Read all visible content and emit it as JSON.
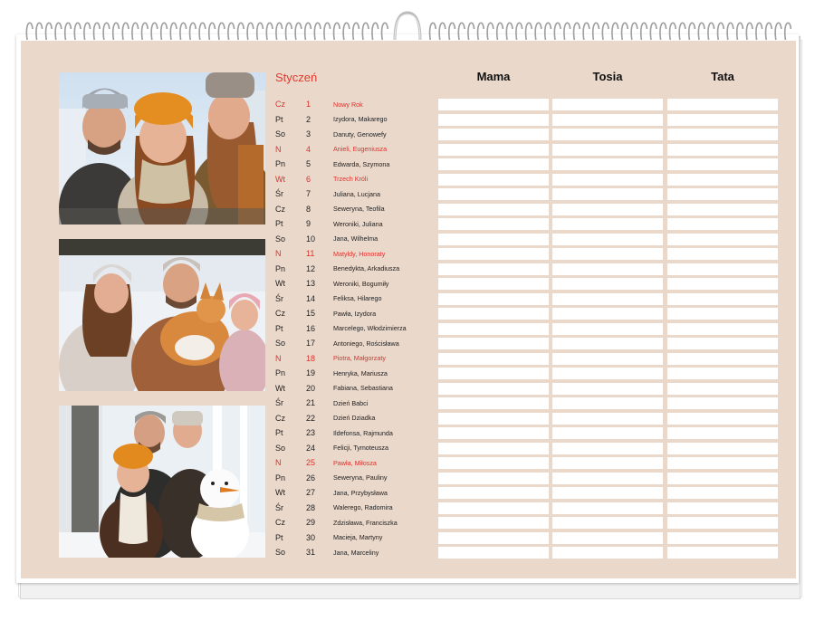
{
  "calendar": {
    "month": "Styczeń",
    "accent_color": "#e03a2e",
    "background_color": "#ead8cb",
    "columns": [
      "Mama",
      "Tosia",
      "Tata"
    ],
    "days": [
      {
        "dn": "Cz",
        "num": "1",
        "name": "Nowy Rok",
        "red": true
      },
      {
        "dn": "Pt",
        "num": "2",
        "name": "Izydora, Makarego",
        "red": false
      },
      {
        "dn": "So",
        "num": "3",
        "name": "Danuty, Genowefy",
        "red": false
      },
      {
        "dn": "N",
        "num": "4",
        "name": "Anieli, Eugeniusza",
        "red": true
      },
      {
        "dn": "Pn",
        "num": "5",
        "name": "Edwarda, Szymona",
        "red": false
      },
      {
        "dn": "Wt",
        "num": "6",
        "name": "Trzech Króli",
        "red": true
      },
      {
        "dn": "Śr",
        "num": "7",
        "name": "Juliana, Lucjana",
        "red": false
      },
      {
        "dn": "Cz",
        "num": "8",
        "name": "Seweryna, Teofila",
        "red": false
      },
      {
        "dn": "Pt",
        "num": "9",
        "name": "Weroniki, Juliana",
        "red": false
      },
      {
        "dn": "So",
        "num": "10",
        "name": "Jana, Wilhelma",
        "red": false
      },
      {
        "dn": "N",
        "num": "11",
        "name": "Matyldy, Honoraty",
        "red": true
      },
      {
        "dn": "Pn",
        "num": "12",
        "name": "Benedykta, Arkadiusza",
        "red": false
      },
      {
        "dn": "Wt",
        "num": "13",
        "name": "Weroniki, Bogumiły",
        "red": false
      },
      {
        "dn": "Śr",
        "num": "14",
        "name": "Feliksa, Hilarego",
        "red": false
      },
      {
        "dn": "Cz",
        "num": "15",
        "name": "Pawła, Izydora",
        "red": false
      },
      {
        "dn": "Pt",
        "num": "16",
        "name": "Marcelego, Włodzimierza",
        "red": false
      },
      {
        "dn": "So",
        "num": "17",
        "name": "Antoniego, Rościsława",
        "red": false
      },
      {
        "dn": "N",
        "num": "18",
        "name": "Piotra, Małgorzaty",
        "red": true
      },
      {
        "dn": "Pn",
        "num": "19",
        "name": "Henryka, Mariusza",
        "red": false
      },
      {
        "dn": "Wt",
        "num": "20",
        "name": "Fabiana, Sebastiana",
        "red": false
      },
      {
        "dn": "Śr",
        "num": "21",
        "name": "Dzień Babci",
        "red": false
      },
      {
        "dn": "Cz",
        "num": "22",
        "name": "Dzień Dziadka",
        "red": false
      },
      {
        "dn": "Pt",
        "num": "23",
        "name": "Ildefonsa, Rajmunda",
        "red": false
      },
      {
        "dn": "So",
        "num": "24",
        "name": "Felicji, Tymoteusza",
        "red": false
      },
      {
        "dn": "N",
        "num": "25",
        "name": "Pawła, Miłosza",
        "red": true
      },
      {
        "dn": "Pn",
        "num": "26",
        "name": "Seweryna, Pauliny",
        "red": false
      },
      {
        "dn": "Wt",
        "num": "27",
        "name": "Jana, Przybysława",
        "red": false
      },
      {
        "dn": "Śr",
        "num": "28",
        "name": "Walerego, Radomira",
        "red": false
      },
      {
        "dn": "Cz",
        "num": "29",
        "name": "Zdzisława, Franciszka",
        "red": false
      },
      {
        "dn": "Pt",
        "num": "30",
        "name": "Macieja, Martyny",
        "red": false
      },
      {
        "dn": "So",
        "num": "31",
        "name": "Jana, Marceliny",
        "red": false
      }
    ]
  },
  "photos": [
    {
      "name": "family-selfie-photo"
    },
    {
      "name": "family-with-dog-photo"
    },
    {
      "name": "family-with-snowman-photo"
    }
  ]
}
